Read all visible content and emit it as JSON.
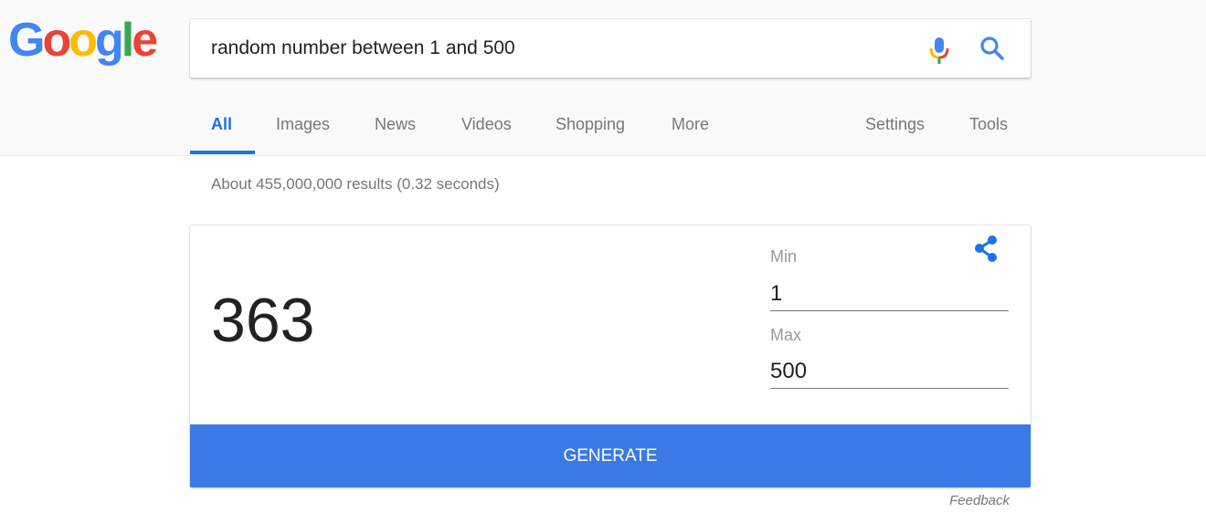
{
  "logo": {
    "letters": [
      "G",
      "o",
      "o",
      "g",
      "l",
      "e"
    ],
    "colors": [
      "#4285f4",
      "#ea4335",
      "#fbbc05",
      "#4285f4",
      "#34a853",
      "#ea4335"
    ]
  },
  "search": {
    "query": "random number between 1 and 500",
    "mic_icon": "microphone-icon",
    "search_icon": "magnifier-icon"
  },
  "tabs": {
    "items": [
      {
        "label": "All",
        "active": true
      },
      {
        "label": "Images"
      },
      {
        "label": "News"
      },
      {
        "label": "Videos"
      },
      {
        "label": "Shopping"
      },
      {
        "label": "More"
      }
    ],
    "settings_label": "Settings",
    "tools_label": "Tools",
    "active_color": "#1a73e8"
  },
  "results": {
    "stats": "About 455,000,000 results (0.32 seconds)"
  },
  "random_number_card": {
    "value": "363",
    "share_icon": "share-icon",
    "min_label": "Min",
    "min_value": "1",
    "max_label": "Max",
    "max_value": "500",
    "generate_label": "GENERATE",
    "button_color": "#3b7ae4"
  },
  "feedback_label": "Feedback"
}
